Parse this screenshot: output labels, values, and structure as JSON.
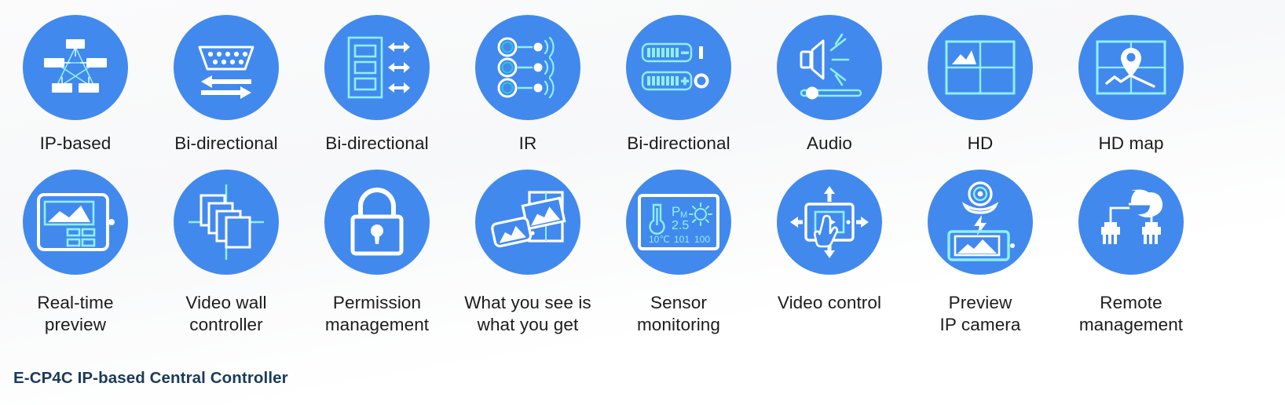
{
  "theme": {
    "circle_blue": "#4289ee",
    "icon_stroke": "#ffffff",
    "icon_accent": "#7ff0f6",
    "label_color": "#1c1c1c",
    "footer_color": "#1b3a5c",
    "background": "#ffffff"
  },
  "footer": {
    "title": "E-CP4C IP-based Central Controller"
  },
  "rows": [
    {
      "items": [
        {
          "icon": "ip-network-star-icon",
          "label_line1": "IP-based",
          "label_line2": ""
        },
        {
          "icon": "bidirectional-connector-icon",
          "label_line1": "Bi-directional",
          "label_line2": ""
        },
        {
          "icon": "bidirectional-rack-icon",
          "label_line1": "Bi-directional",
          "label_line2": ""
        },
        {
          "icon": "infrared-remote-icon",
          "label_line1": "IR",
          "label_line2": ""
        },
        {
          "icon": "bidirectional-keypad-icon",
          "label_line1": "Bi-directional",
          "label_line2": ""
        },
        {
          "icon": "audio-speaker-slider-icon",
          "label_line1": "Audio",
          "label_line2": ""
        },
        {
          "icon": "hd-videowall-icon",
          "label_line1": "HD",
          "label_line2": ""
        },
        {
          "icon": "hd-map-pin-icon",
          "label_line1": "HD map",
          "label_line2": ""
        }
      ]
    },
    {
      "items": [
        {
          "icon": "realtime-tablet-preview-icon",
          "label_line1": "Real-time",
          "label_line2": "preview"
        },
        {
          "icon": "video-wall-layers-icon",
          "label_line1": "Video wall",
          "label_line2": "controller"
        },
        {
          "icon": "permission-lock-icon",
          "label_line1": "Permission",
          "label_line2": "management"
        },
        {
          "icon": "what-you-see-is-icon",
          "label_line1": "What you see is",
          "label_line2": "what you get"
        },
        {
          "icon": "environment-sensor-icon",
          "label_line1": "Sensor",
          "label_line2": "monitoring"
        },
        {
          "icon": "video-control-touch-icon",
          "label_line1": "Video control",
          "label_line2": ""
        },
        {
          "icon": "camera-preview-icon",
          "label_line1": "Preview",
          "label_line2": "IP camera"
        },
        {
          "icon": "remote-network-icon",
          "label_line1": "Remote",
          "label_line2": "management"
        }
      ]
    }
  ],
  "sensor_icon_readout": {
    "pm_label": "P",
    "pm_sub": "M",
    "pm_value": "2.5",
    "temperature": "10℃",
    "value_mid": "101",
    "value_right": "100"
  }
}
